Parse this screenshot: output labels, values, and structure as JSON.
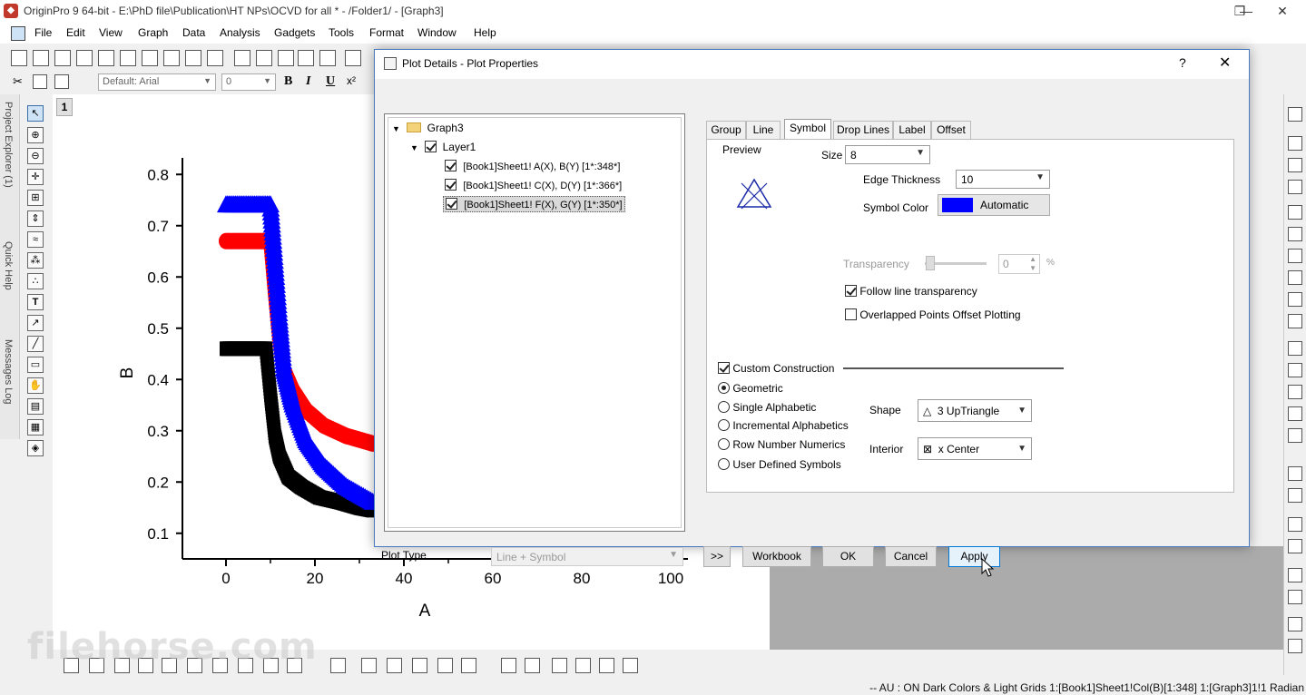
{
  "window": {
    "title": "OriginPro 9 64-bit - E:\\PhD file\\Publication\\HT NPs\\OCVD for all * - /Folder1/ - [Graph3]",
    "minimize": "—",
    "restore": "❐",
    "close": "✕"
  },
  "menu": [
    "File",
    "Edit",
    "View",
    "Graph",
    "Data",
    "Analysis",
    "Gadgets",
    "Tools",
    "Format",
    "Window",
    "Help"
  ],
  "toolbar": {
    "font_combo": "Default: Arial",
    "size_combo": "0",
    "bold": "B",
    "italic": "I",
    "underline": "U"
  },
  "left_panels": [
    "Project Explorer (1)",
    "Quick Help",
    "Messages Log"
  ],
  "page_number": "1",
  "chart_data": {
    "type": "scatter",
    "xlabel": "A",
    "ylabel": "B",
    "xlim": [
      0,
      100
    ],
    "ylim": [
      0.05,
      0.85
    ],
    "x_ticks": [
      "0",
      "20",
      "40",
      "60",
      "80",
      "100"
    ],
    "y_ticks": [
      "0.1",
      "0.2",
      "0.3",
      "0.4",
      "0.5",
      "0.6",
      "0.7",
      "0.8"
    ],
    "series": [
      {
        "color": "#000000",
        "marker": "square",
        "x": [
          0,
          4,
          9,
          10,
          11,
          12,
          14,
          17,
          21,
          26,
          30,
          33
        ],
        "y": [
          0.46,
          0.46,
          0.46,
          0.37,
          0.29,
          0.25,
          0.21,
          0.19,
          0.17,
          0.16,
          0.15,
          0.145
        ]
      },
      {
        "color": "#ff0000",
        "marker": "circle",
        "x": [
          0,
          5,
          10,
          11,
          12,
          13,
          15,
          18,
          22,
          27,
          33
        ],
        "y": [
          0.67,
          0.67,
          0.67,
          0.57,
          0.48,
          0.42,
          0.38,
          0.34,
          0.31,
          0.29,
          0.275
        ]
      },
      {
        "color": "#0000ff",
        "marker": "triangle",
        "x": [
          0,
          5,
          10,
          11,
          12,
          13,
          15,
          18,
          22,
          27,
          33
        ],
        "y": [
          0.74,
          0.74,
          0.74,
          0.63,
          0.52,
          0.42,
          0.35,
          0.28,
          0.23,
          0.19,
          0.16
        ]
      }
    ]
  },
  "dialog": {
    "title": "Plot Details - Plot Properties",
    "help": "?",
    "close": "✕",
    "tree": {
      "root": "Graph3",
      "layer": "Layer1",
      "plots": [
        "[Book1]Sheet1! A(X), B(Y) [1*:348*]",
        "[Book1]Sheet1! C(X), D(Y) [1*:366*]",
        "[Book1]Sheet1! F(X), G(Y) [1*:350*]"
      ]
    },
    "tabs": [
      "Group",
      "Line",
      "Symbol",
      "Drop Lines",
      "Label",
      "Offset"
    ],
    "symbol": {
      "preview_label": "Preview",
      "size_label": "Size",
      "size_value": "8",
      "edge_thickness_label": "Edge Thickness",
      "edge_thickness_value": "10",
      "symbol_color_label": "Symbol Color",
      "symbol_color_value": "Automatic",
      "symbol_color_hex": "#0000ff",
      "transparency_label": "Transparency",
      "transparency_value": "0",
      "transparency_unit": "%",
      "follow_line_label": "Follow line transparency",
      "overlapped_label": "Overlapped Points Offset Plotting",
      "custom_construction_label": "Custom Construction",
      "radios": [
        "Geometric",
        "Single Alphabetic",
        "Incremental Alphabetics",
        "Row Number Numerics",
        "User Defined Symbols"
      ],
      "shape_label": "Shape",
      "shape_value": "3 UpTriangle",
      "interior_label": "Interior",
      "interior_value": "x Center"
    },
    "plot_type_label": "Plot Type",
    "plot_type_value": "Line + Symbol",
    "buttons": {
      "more": ">>",
      "workbook": "Workbook",
      "ok": "OK",
      "cancel": "Cancel",
      "apply": "Apply"
    }
  },
  "status": "-- AU : ON  Dark Colors & Light Grids  1:[Book1]Sheet1!Col(B)[1:348]  1:[Graph3]1!1  Radian",
  "watermark": "filehorse.com"
}
